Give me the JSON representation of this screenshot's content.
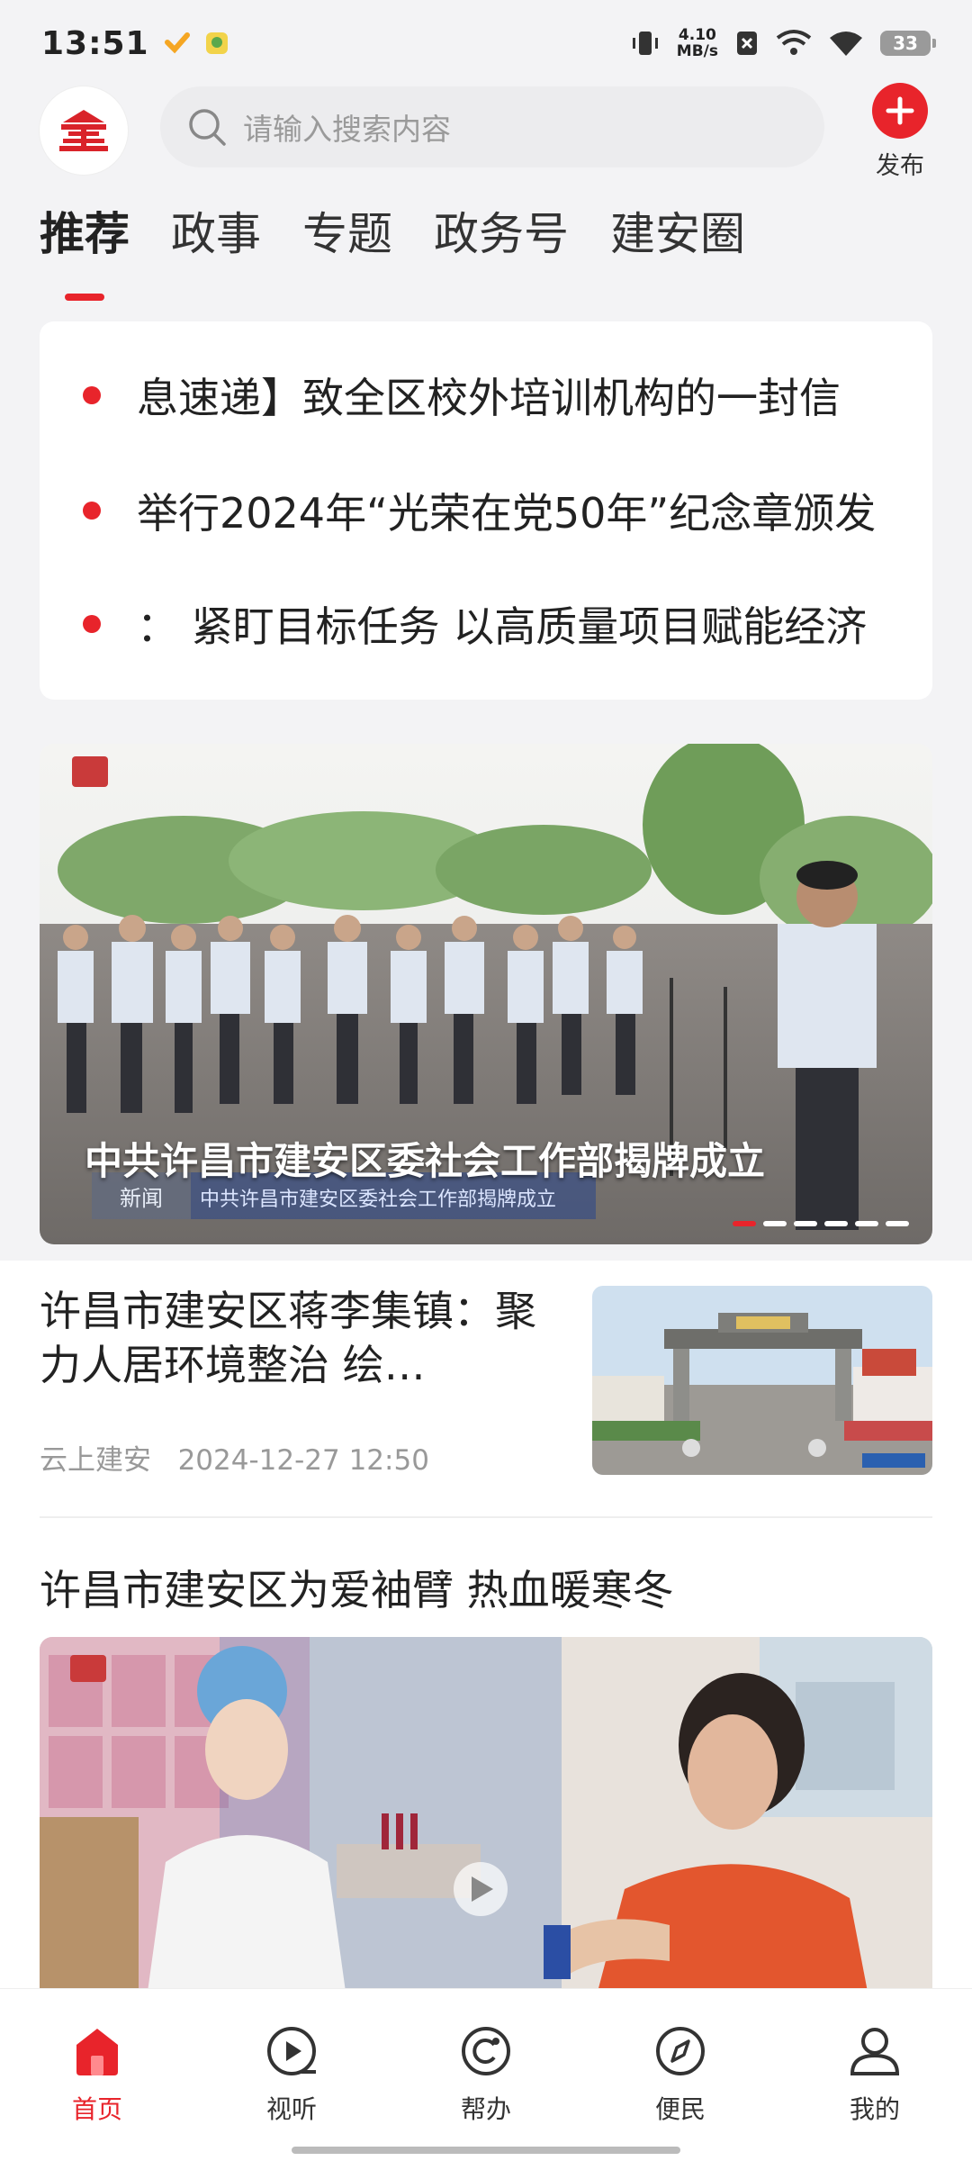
{
  "status_bar": {
    "time": "13:51",
    "net_speed_value": "4.10",
    "net_speed_unit": "MB/s",
    "battery": "33",
    "icons": [
      "vibrate-icon",
      "no-sim-icon",
      "signal-icon",
      "wifi-icon"
    ]
  },
  "header": {
    "search_placeholder": "请输入搜索内容",
    "publish_label": "发布"
  },
  "tabs": [
    {
      "label": "推荐",
      "active": true
    },
    {
      "label": "政事",
      "active": false
    },
    {
      "label": "专题",
      "active": false
    },
    {
      "label": "政务号",
      "active": false
    },
    {
      "label": "建安圈",
      "active": false
    }
  ],
  "ticker": [
    "息速递】致全区校外培训机构的一封信",
    "举行2024年“光荣在党50年”纪念章颁发",
    "：  紧盯目标任务 以高质量项目赋能经济"
  ],
  "carousel": {
    "caption": "中共许昌市建安区委社会工作部揭牌成立",
    "slide_count": 6,
    "active_slide": 1
  },
  "news": [
    {
      "title": "许昌市建安区蒋李集镇：聚力人居环境整治 绘…",
      "source": "云上建安",
      "time": "2024-12-27 12:50"
    },
    {
      "title": "许昌市建安区为爱袖臂  热血暖寒冬"
    }
  ],
  "bottom_nav": [
    {
      "label": "首页",
      "icon": "home-icon",
      "active": true
    },
    {
      "label": "视听",
      "icon": "play-icon",
      "active": false
    },
    {
      "label": "帮办",
      "icon": "help-icon",
      "active": false
    },
    {
      "label": "便民",
      "icon": "compass-icon",
      "active": false
    },
    {
      "label": "我的",
      "icon": "user-icon",
      "active": false
    }
  ],
  "colors": {
    "accent": "#e8242b",
    "background": "#f3f3f5"
  }
}
